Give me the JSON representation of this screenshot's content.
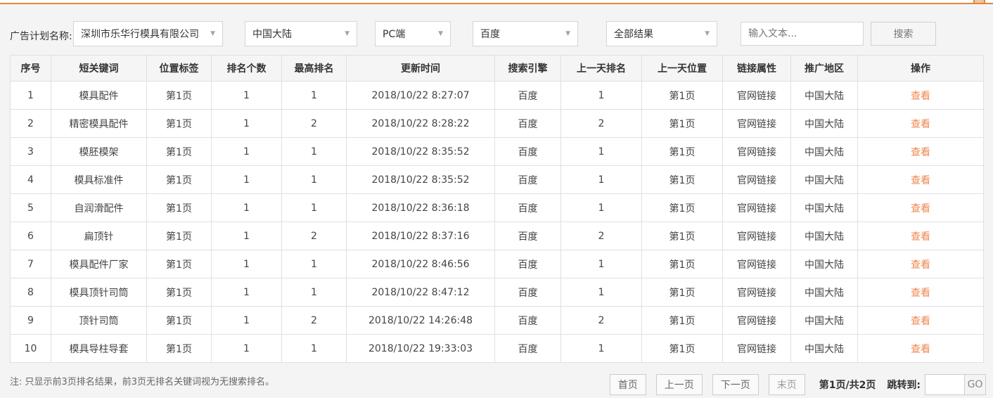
{
  "colors": {
    "accent_orange": "#e0873a",
    "link_orange": "#f0854e",
    "page_background": "#f4f4f4"
  },
  "icons": {
    "chevron_down": "▼"
  },
  "filter_bar": {
    "label": "广告计划名称:",
    "dropdowns": [
      {
        "value": "深圳市乐华行模具有限公司"
      },
      {
        "value": "中国大陆"
      },
      {
        "value": "PC端"
      },
      {
        "value": "百度"
      },
      {
        "value": "全部结果"
      }
    ],
    "search_input_placeholder": "输入文本...",
    "search_button": "搜索"
  },
  "table": {
    "headers": [
      "序号",
      "短关键词",
      "位置标签",
      "排名个数",
      "最高排名",
      "更新时间",
      "搜索引擎",
      "上一天排名",
      "上一天位置",
      "链接属性",
      "推广地区",
      "操作"
    ],
    "rows": [
      {
        "index": "1",
        "keyword": "模具配件",
        "position": "第1页",
        "rank_count": "1",
        "best_rank": "1",
        "updated": "2018/10/22 8:27:07",
        "engine": "百度",
        "prev_rank": "1",
        "prev_position": "第1页",
        "link_attr": "官网链接",
        "region": "中国大陆",
        "action": "查看"
      },
      {
        "index": "2",
        "keyword": "精密模具配件",
        "position": "第1页",
        "rank_count": "1",
        "best_rank": "2",
        "updated": "2018/10/22 8:28:22",
        "engine": "百度",
        "prev_rank": "2",
        "prev_position": "第1页",
        "link_attr": "官网链接",
        "region": "中国大陆",
        "action": "查看"
      },
      {
        "index": "3",
        "keyword": "模胚模架",
        "position": "第1页",
        "rank_count": "1",
        "best_rank": "1",
        "updated": "2018/10/22 8:35:52",
        "engine": "百度",
        "prev_rank": "1",
        "prev_position": "第1页",
        "link_attr": "官网链接",
        "region": "中国大陆",
        "action": "查看"
      },
      {
        "index": "4",
        "keyword": "模具标准件",
        "position": "第1页",
        "rank_count": "1",
        "best_rank": "1",
        "updated": "2018/10/22 8:35:52",
        "engine": "百度",
        "prev_rank": "1",
        "prev_position": "第1页",
        "link_attr": "官网链接",
        "region": "中国大陆",
        "action": "查看"
      },
      {
        "index": "5",
        "keyword": "自润滑配件",
        "position": "第1页",
        "rank_count": "1",
        "best_rank": "1",
        "updated": "2018/10/22 8:36:18",
        "engine": "百度",
        "prev_rank": "1",
        "prev_position": "第1页",
        "link_attr": "官网链接",
        "region": "中国大陆",
        "action": "查看"
      },
      {
        "index": "6",
        "keyword": "扁顶针",
        "position": "第1页",
        "rank_count": "1",
        "best_rank": "2",
        "updated": "2018/10/22 8:37:16",
        "engine": "百度",
        "prev_rank": "2",
        "prev_position": "第1页",
        "link_attr": "官网链接",
        "region": "中国大陆",
        "action": "查看"
      },
      {
        "index": "7",
        "keyword": "模具配件厂家",
        "position": "第1页",
        "rank_count": "1",
        "best_rank": "1",
        "updated": "2018/10/22 8:46:56",
        "engine": "百度",
        "prev_rank": "1",
        "prev_position": "第1页",
        "link_attr": "官网链接",
        "region": "中国大陆",
        "action": "查看"
      },
      {
        "index": "8",
        "keyword": "模具顶针司筒",
        "position": "第1页",
        "rank_count": "1",
        "best_rank": "1",
        "updated": "2018/10/22 8:47:12",
        "engine": "百度",
        "prev_rank": "1",
        "prev_position": "第1页",
        "link_attr": "官网链接",
        "region": "中国大陆",
        "action": "查看"
      },
      {
        "index": "9",
        "keyword": "顶针司筒",
        "position": "第1页",
        "rank_count": "1",
        "best_rank": "2",
        "updated": "2018/10/22 14:26:48",
        "engine": "百度",
        "prev_rank": "2",
        "prev_position": "第1页",
        "link_attr": "官网链接",
        "region": "中国大陆",
        "action": "查看"
      },
      {
        "index": "10",
        "keyword": "模具导柱导套",
        "position": "第1页",
        "rank_count": "1",
        "best_rank": "1",
        "updated": "2018/10/22 19:33:03",
        "engine": "百度",
        "prev_rank": "1",
        "prev_position": "第1页",
        "link_attr": "官网链接",
        "region": "中国大陆",
        "action": "查看"
      }
    ]
  },
  "footer": {
    "note": "注: 只显示前3页排名结果，前3页无排名关键词视为无搜索排名。",
    "pagination": {
      "first": "首页",
      "prev": "上一页",
      "next": "下一页",
      "last": "末页",
      "page_info": "第1页/共2页",
      "jump_label": "跳转到:",
      "go": "GO"
    }
  }
}
